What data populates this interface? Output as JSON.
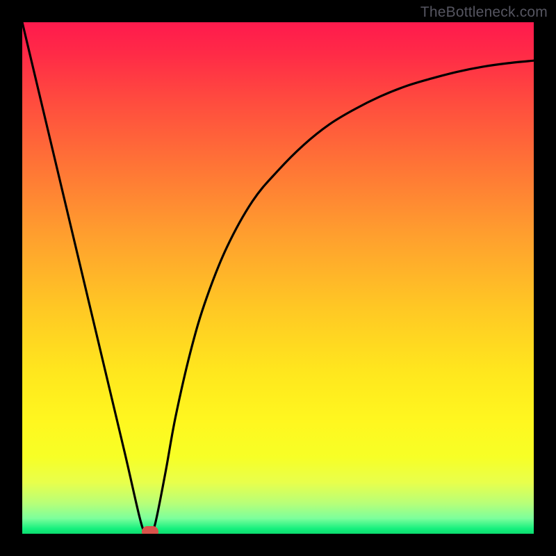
{
  "watermark": "TheBottleneck.com",
  "chart_data": {
    "type": "line",
    "title": "",
    "xlabel": "",
    "ylabel": "",
    "xlim": [
      0,
      100
    ],
    "ylim": [
      0,
      100
    ],
    "axes_shown": false,
    "grid": false,
    "background_gradient": {
      "top": "#ff1a4d",
      "bottom": "#0cdc6f",
      "desc": "red-orange-yellow-green vertical gradient"
    },
    "series": [
      {
        "name": "bottleneck-curve",
        "color": "#000000",
        "x": [
          0,
          5,
          10,
          15,
          20,
          23,
          24,
          25,
          26,
          28,
          30,
          33,
          36,
          40,
          45,
          50,
          55,
          60,
          65,
          70,
          75,
          80,
          85,
          90,
          95,
          100
        ],
        "values": [
          100,
          79,
          58,
          37,
          16,
          3,
          0.5,
          0,
          2,
          12,
          23,
          36,
          46,
          56,
          65,
          71,
          76,
          80,
          83,
          85.5,
          87.5,
          89,
          90.3,
          91.3,
          92,
          92.5
        ]
      }
    ],
    "marker": {
      "name": "optimal-point",
      "x": 25,
      "y": 0,
      "color": "#d9534b",
      "shape": "pill"
    }
  }
}
